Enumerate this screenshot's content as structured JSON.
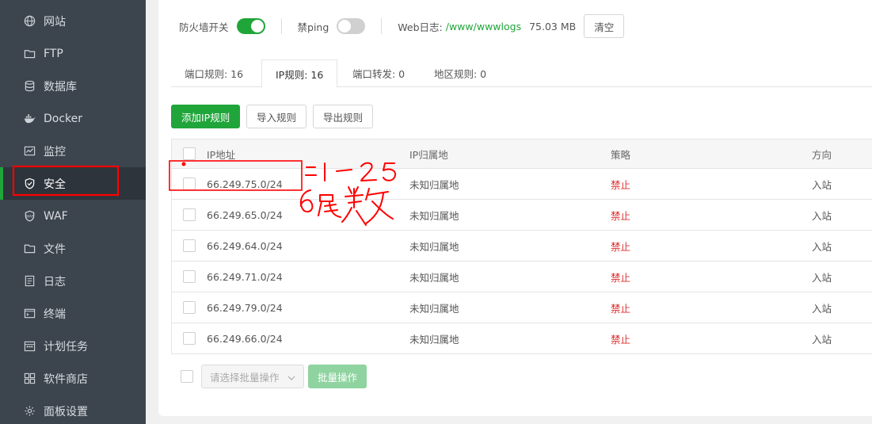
{
  "sidebar": {
    "items": [
      {
        "label": "网站",
        "icon": "globe-icon"
      },
      {
        "label": "FTP",
        "icon": "ftp-icon"
      },
      {
        "label": "数据库",
        "icon": "database-icon"
      },
      {
        "label": "Docker",
        "icon": "docker-icon"
      },
      {
        "label": "监控",
        "icon": "monitor-icon"
      },
      {
        "label": "安全",
        "icon": "shield-icon",
        "active": true
      },
      {
        "label": "WAF",
        "icon": "waf-icon"
      },
      {
        "label": "文件",
        "icon": "folder-icon"
      },
      {
        "label": "日志",
        "icon": "log-icon"
      },
      {
        "label": "终端",
        "icon": "terminal-icon"
      },
      {
        "label": "计划任务",
        "icon": "calendar-icon"
      },
      {
        "label": "软件商店",
        "icon": "apps-icon"
      },
      {
        "label": "面板设置",
        "icon": "gear-icon"
      }
    ]
  },
  "topbar": {
    "firewall_label": "防火墙开关",
    "firewall_on": true,
    "ping_label": "禁ping",
    "ping_on": false,
    "weblog_label": "Web日志:",
    "weblog_path": "/www/wwwlogs",
    "weblog_size": "75.03 MB",
    "clear_label": "清空"
  },
  "tabs": [
    {
      "label": "端口规则: 16"
    },
    {
      "label": "IP规则: 16",
      "active": true
    },
    {
      "label": "端口转发: 0"
    },
    {
      "label": "地区规则: 0"
    }
  ],
  "actions": {
    "add_label": "添加IP规则",
    "import_label": "导入规则",
    "export_label": "导出规则"
  },
  "table": {
    "headers": {
      "ip": "IP地址",
      "location": "IP归属地",
      "policy": "策略",
      "direction": "方向"
    },
    "rows": [
      {
        "ip": "66.249.75.0/24",
        "location": "未知归属地",
        "policy": "禁止",
        "direction": "入站"
      },
      {
        "ip": "66.249.65.0/24",
        "location": "未知归属地",
        "policy": "禁止",
        "direction": "入站"
      },
      {
        "ip": "66.249.64.0/24",
        "location": "未知归属地",
        "policy": "禁止",
        "direction": "入站"
      },
      {
        "ip": "66.249.71.0/24",
        "location": "未知归属地",
        "policy": "禁止",
        "direction": "入站"
      },
      {
        "ip": "66.249.79.0/24",
        "location": "未知归属地",
        "policy": "禁止",
        "direction": "入站"
      },
      {
        "ip": "66.249.66.0/24",
        "location": "未知归属地",
        "policy": "禁止",
        "direction": "入站"
      }
    ]
  },
  "batch": {
    "select_placeholder": "请选择批量操作",
    "button_label": "批量操作"
  },
  "colors": {
    "accent": "#20a53a",
    "deny": "#e12d2d",
    "annotation": "#ff0000"
  }
}
